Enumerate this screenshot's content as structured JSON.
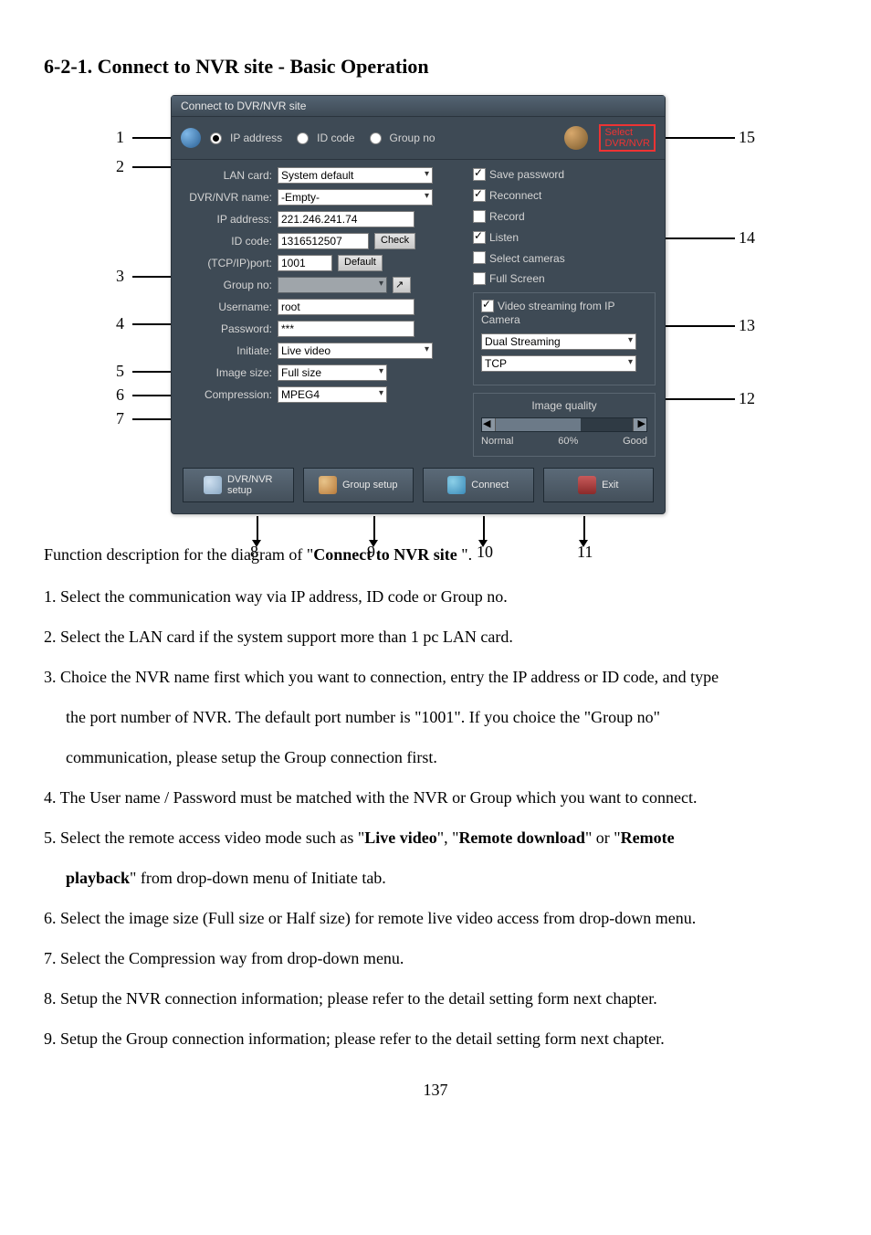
{
  "heading": "6-2-1.  Connect to NVR site - Basic Operation",
  "dialog": {
    "title": "Connect to DVR/NVR site",
    "radio": {
      "ip": "IP address",
      "id": "ID code",
      "group": "Group no"
    },
    "select_dvr": "Select\nDVR/NVR",
    "left": {
      "lan_card_label": "LAN card:",
      "lan_card_value": "System default",
      "name_label": "DVR/NVR name:",
      "name_value": "-Empty-",
      "ip_label": "IP address:",
      "ip_value": "221.246.241.74",
      "idcode_label": "ID code:",
      "idcode_value": "1316512507",
      "check_btn": "Check",
      "port_label": "(TCP/IP)port:",
      "port_value": "1001",
      "default_btn": "Default",
      "group_label": "Group no:",
      "group_value": "",
      "group_go": "↗",
      "user_label": "Username:",
      "user_value": "root",
      "pwd_label": "Password:",
      "pwd_value": "***",
      "initiate_label": "Initiate:",
      "initiate_value": "Live video",
      "imgsize_label": "Image size:",
      "imgsize_value": "Full size",
      "comp_label": "Compression:",
      "comp_value": "MPEG4"
    },
    "right": {
      "save_pwd": "Save password",
      "reconnect": "Reconnect",
      "record": "Record",
      "listen": "Listen",
      "select_cameras": "Select cameras",
      "full_screen": "Full Screen",
      "vs_title": "Video streaming from IP Camera",
      "vs_mode": "Dual Streaming",
      "vs_proto": "TCP",
      "iq_title": "Image quality",
      "iq_normal": "Normal",
      "iq_pct": "60%",
      "iq_good": "Good"
    },
    "buttons": {
      "dvr_setup": "DVR/NVR\nsetup",
      "group_setup": "Group setup",
      "connect": "Connect",
      "exit": "Exit"
    }
  },
  "callouts": {
    "1": "1",
    "2": "2",
    "3": "3",
    "4": "4",
    "5": "5",
    "6": "6",
    "7": "7",
    "8": "8",
    "9": "9",
    "10": "10",
    "11": "11",
    "12": "12",
    "13": "13",
    "14": "14",
    "15": "15"
  },
  "intro_prefix": "Function description for the diagram of \"",
  "intro_bold": "Connect to NVR site",
  "intro_suffix": " \".",
  "items": {
    "i1": "1. Select the communication way via IP address, ID code or Group no.",
    "i2": "2. Select the LAN card if the system support more than 1 pc LAN card.",
    "i3a": "3. Choice the NVR name first which you want to connection, entry the IP address or ID code, and type",
    "i3b": "the port number of NVR.    The default port number is \"1001\".    If you choice the \"Group no\"",
    "i3c": "communication, please setup the Group connection first.",
    "i4": "4. The User name / Password must be matched with the NVR or Group which you want to connect.",
    "i5a": "5. Select the remote access video mode such as \"",
    "i5b1": "Live video",
    "i5c": "\", \"",
    "i5b2": "Remote download",
    "i5d": "\" or \"",
    "i5b3": "Remote",
    "i5e_indent_bold": "playback",
    "i5e_rest": "\" from drop-down menu of Initiate tab.",
    "i6": "6. Select the image size (Full size or Half size) for remote live video access from drop-down menu.",
    "i7": "7. Select the Compression way from drop-down menu.",
    "i8": "8. Setup the NVR connection information; please refer to the detail setting form next chapter.",
    "i9": "9. Setup the Group connection information; please refer to the detail setting form next chapter."
  },
  "page_number": "137"
}
